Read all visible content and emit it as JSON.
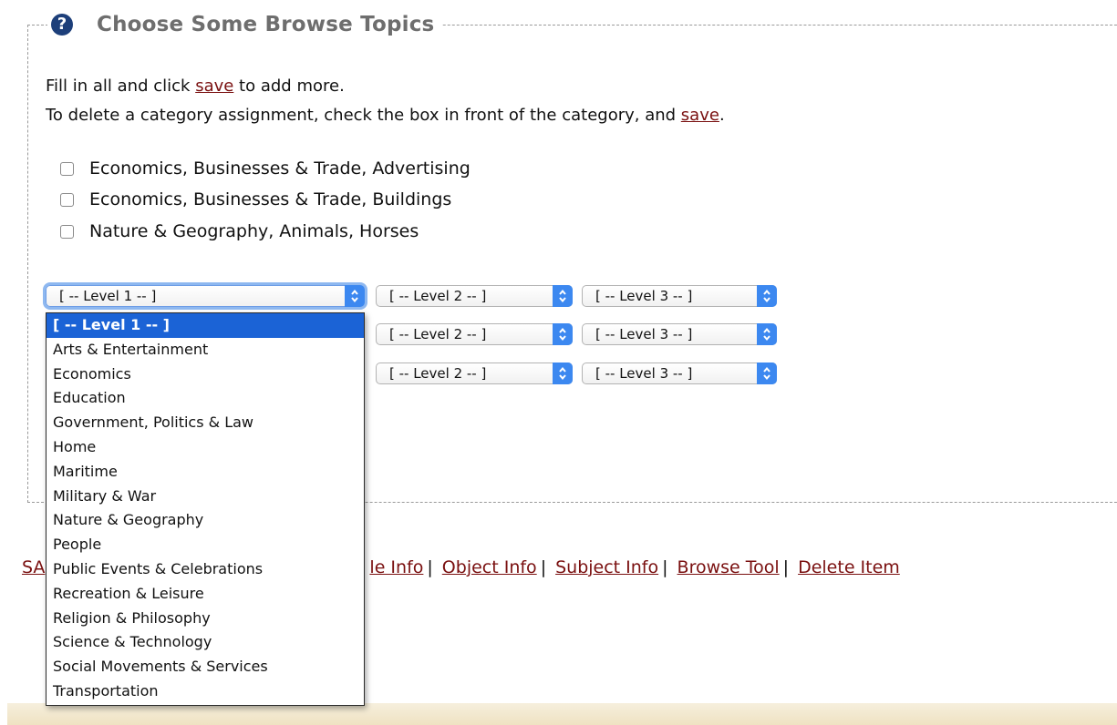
{
  "section": {
    "title": "Choose Some Browse Topics",
    "help_icon": "question-circle-icon"
  },
  "instructions": {
    "line1_prefix": "Fill in all and click ",
    "line1_link": "save",
    "line1_suffix": " to add more.",
    "line2_prefix": "To delete a category assignment, check the box in front of the category, and ",
    "line2_link": "save",
    "line2_suffix": "."
  },
  "categories": [
    {
      "label": "Economics, Businesses & Trade, Advertising",
      "checked": false
    },
    {
      "label": "Economics, Businesses & Trade, Buildings",
      "checked": false
    },
    {
      "label": "Nature & Geography, Animals, Horses",
      "checked": false
    }
  ],
  "selects": {
    "level1": "[ -- Level 1 -- ]",
    "level2": "[ -- Level 2 -- ]",
    "level3": "[ -- Level 3 -- ]"
  },
  "dropdown": {
    "selected": "[ -- Level 1 -- ]",
    "options": [
      "[ -- Level 1 -- ]",
      "Arts & Entertainment",
      "Economics",
      "Education",
      "Government, Politics & Law",
      "Home",
      "Maritime",
      "Military & War",
      "Nature & Geography",
      "People",
      "Public Events & Celebrations",
      "Recreation & Leisure",
      "Religion & Philosophy",
      "Science & Technology",
      "Social Movements & Services",
      "Transportation"
    ]
  },
  "footer_links": {
    "partial_left": "SA",
    "partial_title_info": "le Info",
    "object_info": "Object Info",
    "subject_info": "Subject Info",
    "browse_tool": "Browse Tool",
    "delete_item": "Delete Item",
    "separator": "|"
  },
  "colors": {
    "link": "#7a1010",
    "select_accent": "#3c88f0",
    "dropdown_highlight": "#1b63d6"
  }
}
